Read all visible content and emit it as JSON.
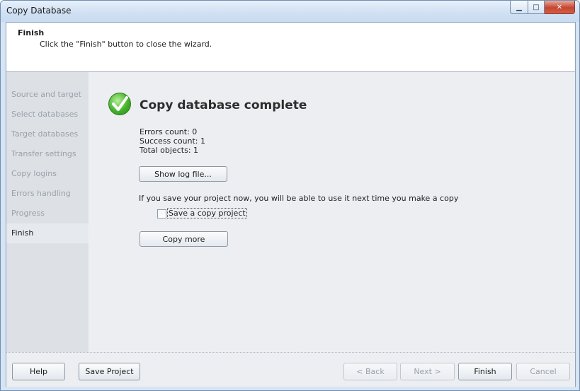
{
  "window": {
    "title": "Copy Database",
    "controls": {
      "minimize": "▁",
      "maximize": "□",
      "close": "✕"
    }
  },
  "header": {
    "title": "Finish",
    "subtitle": "Click the \"Finish\" button to close the wizard."
  },
  "steps": [
    {
      "label": "Source and target",
      "active": false
    },
    {
      "label": "Select databases",
      "active": false
    },
    {
      "label": "Target databases",
      "active": false
    },
    {
      "label": "Transfer settings",
      "active": false
    },
    {
      "label": "Copy logins",
      "active": false
    },
    {
      "label": "Errors handling",
      "active": false
    },
    {
      "label": "Progress",
      "active": false
    },
    {
      "label": "Finish",
      "active": true
    }
  ],
  "main": {
    "title": "Copy database complete",
    "stats": {
      "errors": "Errors count: 0",
      "success": "Success count: 1",
      "total": "Total objects: 1"
    },
    "show_log_label": "Show log file...",
    "info_text": "If you save your project now, you will be able to use it next time you make a copy",
    "save_copy_label": "Save a copy project",
    "save_copy_checked": false,
    "copy_more_label": "Copy more"
  },
  "footer": {
    "help": "Help",
    "save_project": "Save Project",
    "back": "< Back",
    "next": "Next >",
    "finish": "Finish",
    "cancel": "Cancel"
  },
  "colors": {
    "accent": "#43b22a",
    "title_bar": "#d3e2f4",
    "close_button": "#c7452f"
  },
  "icons": [
    "minimize-icon",
    "maximize-icon",
    "close-icon",
    "success-check-icon"
  ]
}
